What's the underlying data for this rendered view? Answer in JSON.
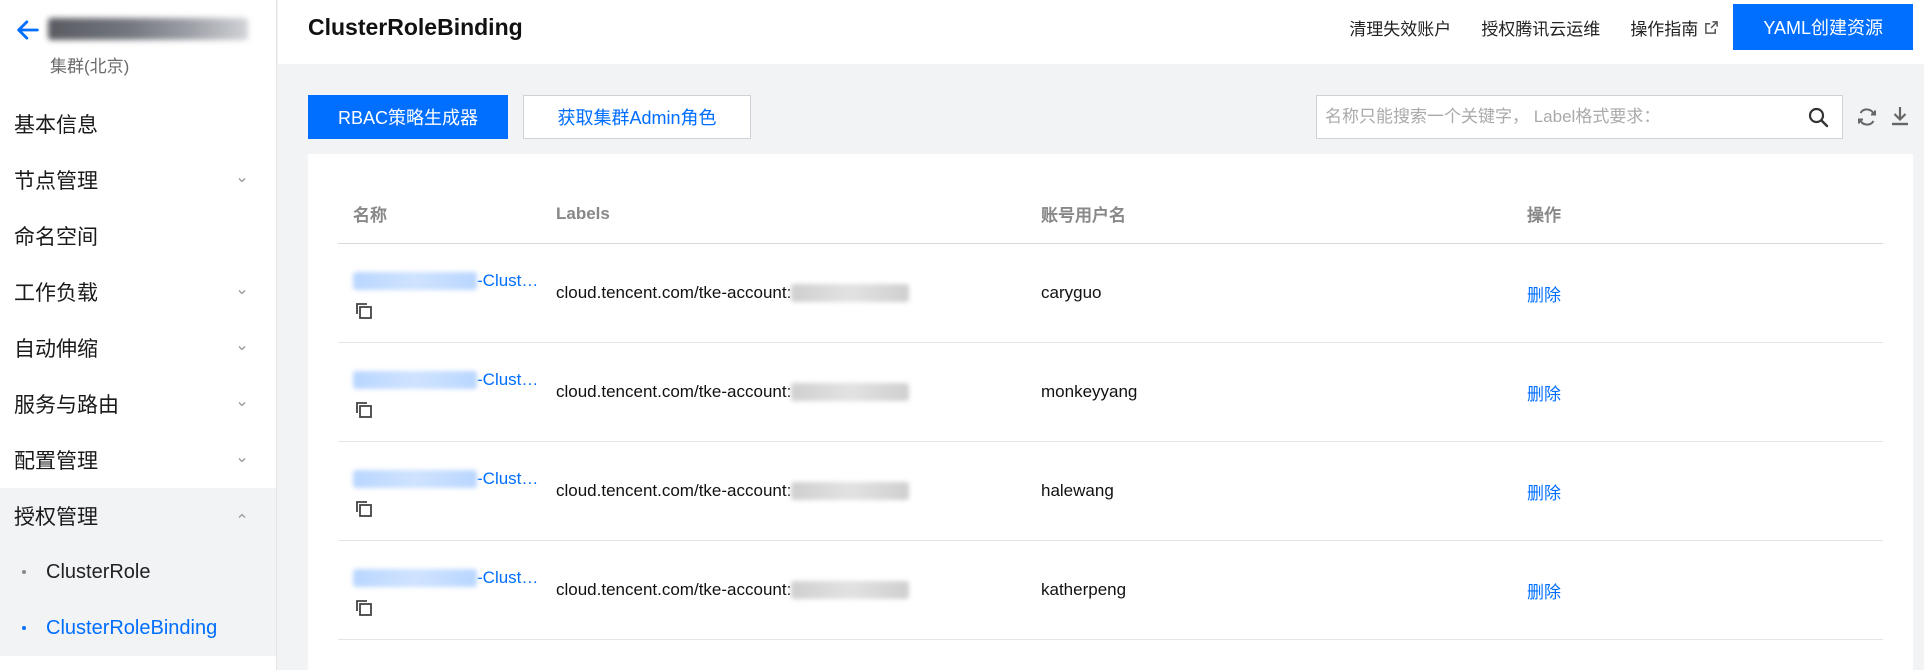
{
  "sidebar": {
    "cluster_region": "集群(北京)",
    "items": [
      {
        "label": "基本信息",
        "expandable": false
      },
      {
        "label": "节点管理",
        "expandable": true
      },
      {
        "label": "命名空间",
        "expandable": false
      },
      {
        "label": "工作负载",
        "expandable": true
      },
      {
        "label": "自动伸缩",
        "expandable": true
      },
      {
        "label": "服务与路由",
        "expandable": true
      },
      {
        "label": "配置管理",
        "expandable": true
      },
      {
        "label": "授权管理",
        "expandable": true,
        "expanded": true
      }
    ],
    "sub_items": [
      {
        "label": "ClusterRole",
        "active": false
      },
      {
        "label": "ClusterRoleBinding",
        "active": true
      }
    ]
  },
  "header": {
    "title": "ClusterRoleBinding",
    "links": [
      "清理失效账户",
      "授权腾讯云运维",
      "操作指南"
    ],
    "create_button": "YAML创建资源"
  },
  "toolbar": {
    "rbac_button": "RBAC策略生成器",
    "admin_button": "获取集群Admin角色",
    "search_placeholder": "名称只能搜索一个关键字， Label格式要求："
  },
  "table": {
    "columns": [
      "名称",
      "Labels",
      "账号用户名",
      "操作"
    ],
    "rows": [
      {
        "name_suffix": "-Clust…",
        "label_prefix": "cloud.tencent.com/tke-account:",
        "username": "caryguo",
        "action": "删除"
      },
      {
        "name_suffix": "-Clust…",
        "label_prefix": "cloud.tencent.com/tke-account:",
        "username": "monkeyyang",
        "action": "删除"
      },
      {
        "name_suffix": "-Clust…",
        "label_prefix": "cloud.tencent.com/tke-account:",
        "username": "halewang",
        "action": "删除"
      },
      {
        "name_suffix": "-Clust…",
        "label_prefix": "cloud.tencent.com/tke-account:",
        "username": "katherpeng",
        "action": "删除"
      }
    ]
  },
  "colors": {
    "primary": "#006eff",
    "background": "#f2f3f5",
    "text": "#000000"
  }
}
